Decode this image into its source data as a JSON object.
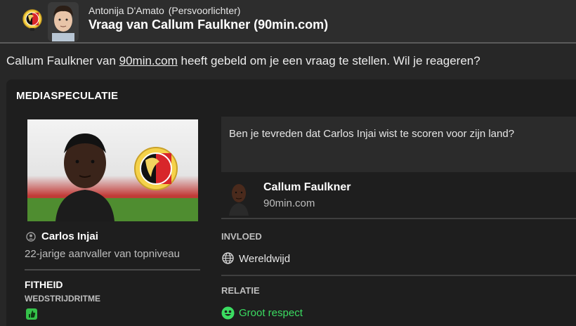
{
  "header": {
    "sender_name": "Antonija D'Amato",
    "sender_role": "(Persvoorlichter)",
    "title": "Vraag van Callum Faulkner (90min.com)"
  },
  "intro": {
    "before": "Callum Faulkner van ",
    "link": "90min.com",
    "after": " heeft gebeld om je een vraag te stellen. Wil je reageren?"
  },
  "panel": {
    "title": "MEDIASPECULATIE",
    "player": {
      "name": "Carlos Injai",
      "description": "22-jarige aanvaller van topniveau"
    },
    "fitness": {
      "title": "FITHEID",
      "subtitle": "WEDSTRIJDRITME"
    },
    "question": "Ben je tevreden dat Carlos Injai wist te scoren voor zijn land?",
    "journalist": {
      "name": "Callum Faulkner",
      "outlet": "90min.com"
    },
    "influence": {
      "title": "INVLOED",
      "value": "Wereldwijd"
    },
    "relation": {
      "title": "RELATIE",
      "value": "Groot respect"
    }
  },
  "colors": {
    "background": "#272727",
    "panel": "#1e1e1e",
    "positive": "#3bdc61",
    "fitness_good": "#35c24a"
  },
  "icons": {
    "club": "club-badge-icon",
    "person": "person-icon",
    "globe": "globe-icon",
    "relation": "smiley-icon",
    "fitness": "thumbs-up-icon"
  }
}
